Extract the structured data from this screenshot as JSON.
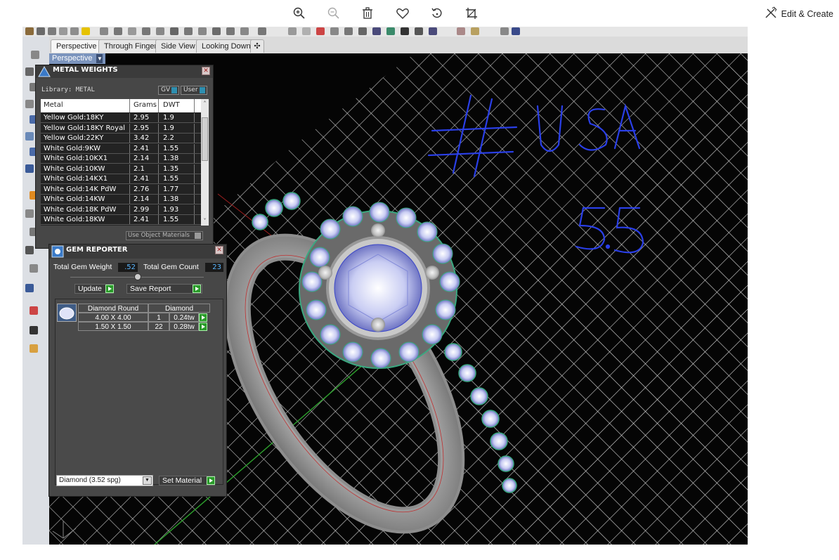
{
  "viewer": {
    "toolbar_icons": [
      "zoom-in-icon",
      "zoom-out-icon",
      "delete-icon",
      "favorite-icon",
      "rotate-icon",
      "crop-icon"
    ],
    "edit_create_label": "Edit & Create"
  },
  "rhino": {
    "tabs": [
      "Perspective",
      "Through Finger",
      "Side View",
      "Looking Down"
    ],
    "viewport_label": "Perspective",
    "handwriting": {
      "line1": "# USA",
      "line2": "5.5"
    },
    "colors": {
      "annotation": "#2a3fe8",
      "grid": "#d8d8d8",
      "panel_bg": "#474747"
    }
  },
  "metal_weights": {
    "title": "METAL WEIGHTS",
    "library_label": "Library: METAL",
    "toggle_gv": "GV",
    "toggle_user": "User",
    "columns": [
      "Metal",
      "Grams",
      "DWT"
    ],
    "rows": [
      {
        "metal": "Yellow Gold:18KY",
        "grams": "2.95",
        "dwt": "1.9"
      },
      {
        "metal": "Yellow Gold:18KY Royal",
        "grams": "2.95",
        "dwt": "1.9"
      },
      {
        "metal": "Yellow Gold:22KY",
        "grams": "3.42",
        "dwt": "2.2"
      },
      {
        "metal": "White Gold:9KW",
        "grams": "2.41",
        "dwt": "1.55"
      },
      {
        "metal": "White Gold:10KX1",
        "grams": "2.14",
        "dwt": "1.38"
      },
      {
        "metal": "White Gold:10KW",
        "grams": "2.1",
        "dwt": "1.35"
      },
      {
        "metal": "White Gold:14KX1",
        "grams": "2.41",
        "dwt": "1.55"
      },
      {
        "metal": "White Gold:14K PdW",
        "grams": "2.76",
        "dwt": "1.77"
      },
      {
        "metal": "White Gold:14KW",
        "grams": "2.14",
        "dwt": "1.38"
      },
      {
        "metal": "White Gold:18K PdW",
        "grams": "2.99",
        "dwt": "1.93"
      },
      {
        "metal": "White Gold:18KW",
        "grams": "2.41",
        "dwt": "1.55"
      }
    ],
    "use_object_materials": "Use Object Materials"
  },
  "gem_reporter": {
    "title": "GEM REPORTER",
    "total_weight_label": "Total Gem Weight",
    "total_weight_value": ".52",
    "total_count_label": "Total Gem Count",
    "total_count_value": "23",
    "update_label": "Update",
    "save_report_label": "Save Report",
    "group_headers": [
      "Diamond Round",
      "Diamond"
    ],
    "rows": [
      {
        "size": "4.00 X 4.00",
        "count": "1",
        "weight": "0.24tw"
      },
      {
        "size": "1.50 X 1.50",
        "count": "22",
        "weight": "0.28tw"
      }
    ],
    "material_select": "Diamond    (3.52 spg)",
    "set_material_label": "Set Material"
  }
}
